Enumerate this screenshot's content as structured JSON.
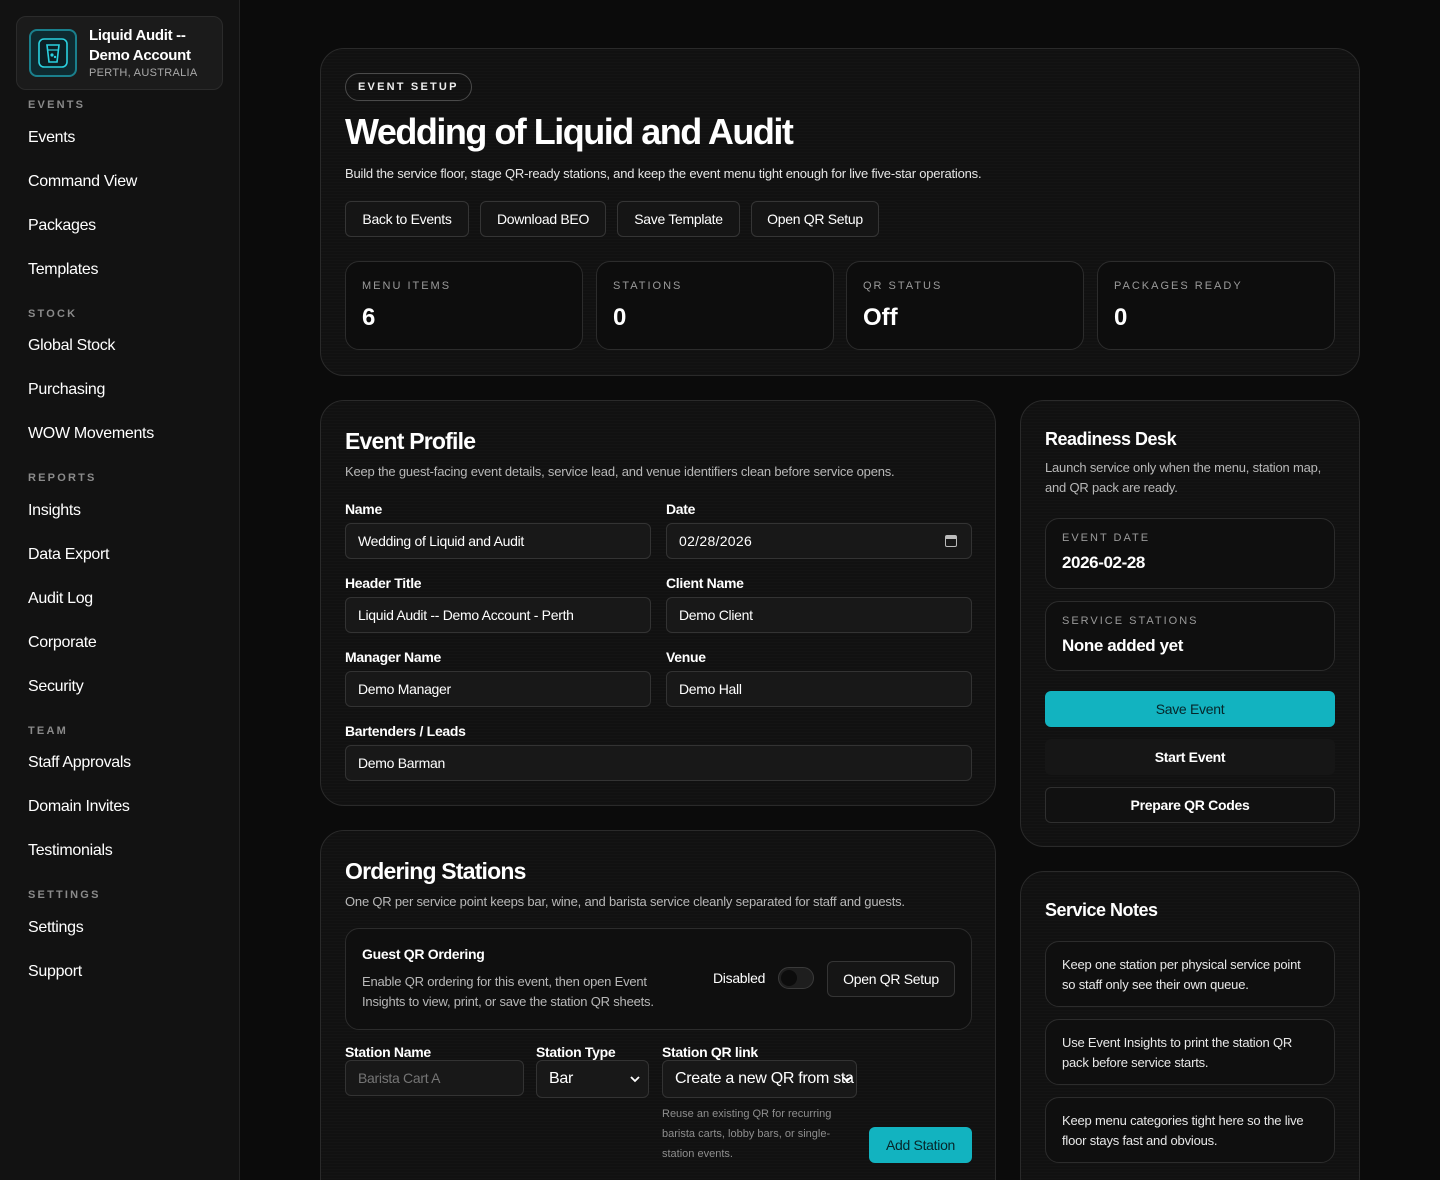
{
  "brand": {
    "title": "Liquid Audit -- Demo Account",
    "location": "PERTH, AUSTRALIA"
  },
  "sidebar": {
    "sections": [
      {
        "title": "EVENTS",
        "items": [
          "Events",
          "Command View",
          "Packages",
          "Templates"
        ]
      },
      {
        "title": "STOCK",
        "items": [
          "Global Stock",
          "Purchasing",
          "WOW Movements"
        ]
      },
      {
        "title": "REPORTS",
        "items": [
          "Insights",
          "Data Export",
          "Audit Log",
          "Corporate",
          "Security"
        ]
      },
      {
        "title": "TEAM",
        "items": [
          "Staff Approvals",
          "Domain Invites",
          "Testimonials"
        ]
      },
      {
        "title": "SETTINGS",
        "items": [
          "Settings",
          "Support"
        ]
      }
    ]
  },
  "hero": {
    "badge": "EVENT SETUP",
    "title": "Wedding of Liquid and Audit",
    "description": "Build the service floor, stage QR-ready stations, and keep the event menu tight enough for live five-star operations.",
    "buttons": [
      "Back to Events",
      "Download BEO",
      "Save Template",
      "Open QR Setup"
    ],
    "stats": [
      {
        "label": "MENU ITEMS",
        "value": "6"
      },
      {
        "label": "STATIONS",
        "value": "0"
      },
      {
        "label": "QR STATUS",
        "value": "Off"
      },
      {
        "label": "PACKAGES READY",
        "value": "0"
      }
    ]
  },
  "profile": {
    "title": "Event Profile",
    "description": "Keep the guest-facing event details, service lead, and venue identifiers clean before service opens.",
    "name_label": "Name",
    "name_value": "Wedding of Liquid and Audit",
    "date_label": "Date",
    "date_value": "02/28/2026",
    "header_label": "Header Title",
    "header_value": "Liquid Audit -- Demo Account - Perth",
    "client_label": "Client Name",
    "client_value": "Demo Client",
    "manager_label": "Manager Name",
    "manager_value": "Demo Manager",
    "venue_label": "Venue",
    "venue_value": "Demo Hall",
    "bartenders_label": "Bartenders / Leads",
    "bartenders_value": "Demo Barman"
  },
  "stations": {
    "title": "Ordering Stations",
    "description": "One QR per service point keeps bar, wine, and barista service cleanly separated for staff and guests.",
    "qr_title": "Guest QR Ordering",
    "qr_desc_line1": "Enable QR ordering for this event, then open Event",
    "qr_desc_line2": "Insights to view, print, or save the station QR sheets.",
    "qr_toggle_label": "Disabled",
    "qr_toggle_on": false,
    "qr_button": "Open QR Setup",
    "station_name_label": "Station Name",
    "station_name_placeholder": "Barista Cart A",
    "station_type_label": "Station Type",
    "station_type_value": "Bar",
    "qr_link_label": "Station QR link",
    "qr_link_value": "Create a new QR from sta",
    "help_line1": "Reuse an existing QR for recurring",
    "help_line2": "barista carts, lobby bars, or single-",
    "help_line3": "station events.",
    "add_button": "Add Station"
  },
  "readiness": {
    "title": "Readiness Desk",
    "desc_line1": "Launch service only when the menu, station map,",
    "desc_line2": "and QR pack are ready.",
    "event_date_label": "EVENT DATE",
    "event_date_value": "2026-02-28",
    "service_stations_label": "SERVICE STATIONS",
    "service_stations_value": "None added yet",
    "save_button": "Save Event",
    "start_button": "Start Event",
    "prepare_button": "Prepare QR Codes",
    "accent": "#12b3c0"
  },
  "notes": {
    "title": "Service Notes",
    "items": [
      [
        "Keep one station per physical service point",
        "so staff only see their own queue."
      ],
      [
        "Use Event Insights to print the station QR",
        "pack before service starts."
      ],
      [
        "Keep menu categories tight here so the live",
        "floor stays fast and obvious."
      ]
    ]
  }
}
